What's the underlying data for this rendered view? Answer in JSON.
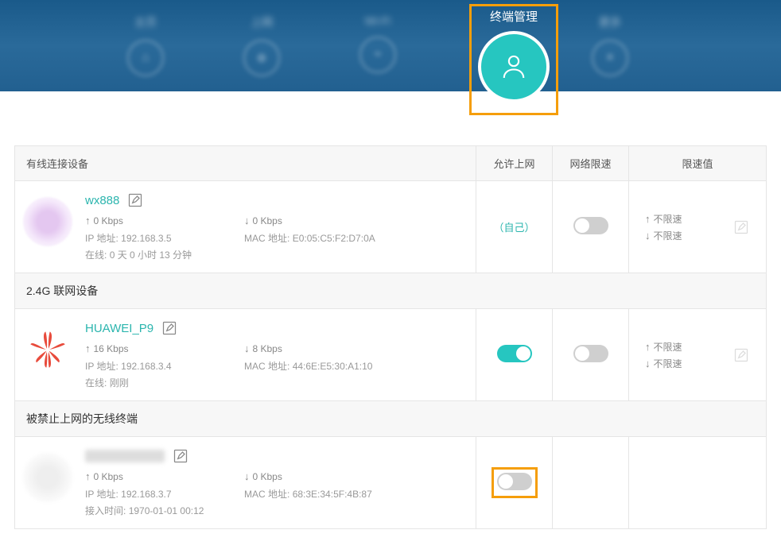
{
  "nav": {
    "active_label": "终端管理"
  },
  "headers": {
    "allow": "允许上网",
    "speed_limit": "网络限速",
    "limit_value": "限速值"
  },
  "sections": {
    "wired": "有线连接设备",
    "wifi24": "2.4G 联网设备",
    "blocked": "被禁止上网的无线终端"
  },
  "labels": {
    "self": "（自己）",
    "no_limit_up": "不限速",
    "no_limit_down": "不限速",
    "ip_prefix": "IP 地址:",
    "mac_prefix": "MAC 地址:",
    "online_prefix": "在线:",
    "access_prefix": "接入时间:"
  },
  "devices": {
    "wired": {
      "name": "wx888",
      "up": "0 Kbps",
      "down": "0 Kbps",
      "ip": "192.168.3.5",
      "mac": "E0:05:C5:F2:D7:0A",
      "online": "0 天 0 小时 13 分钟"
    },
    "wifi24": {
      "name": "HUAWEI_P9",
      "up": "16 Kbps",
      "down": "8 Kbps",
      "ip": "192.168.3.4",
      "mac": "44:6E:E5:30:A1:10",
      "online": "刚刚"
    },
    "blocked": {
      "up": "0 Kbps",
      "down": "0 Kbps",
      "ip": "192.168.3.7",
      "mac": "68:3E:34:5F:4B:87",
      "access": "1970-01-01 00:12"
    }
  }
}
